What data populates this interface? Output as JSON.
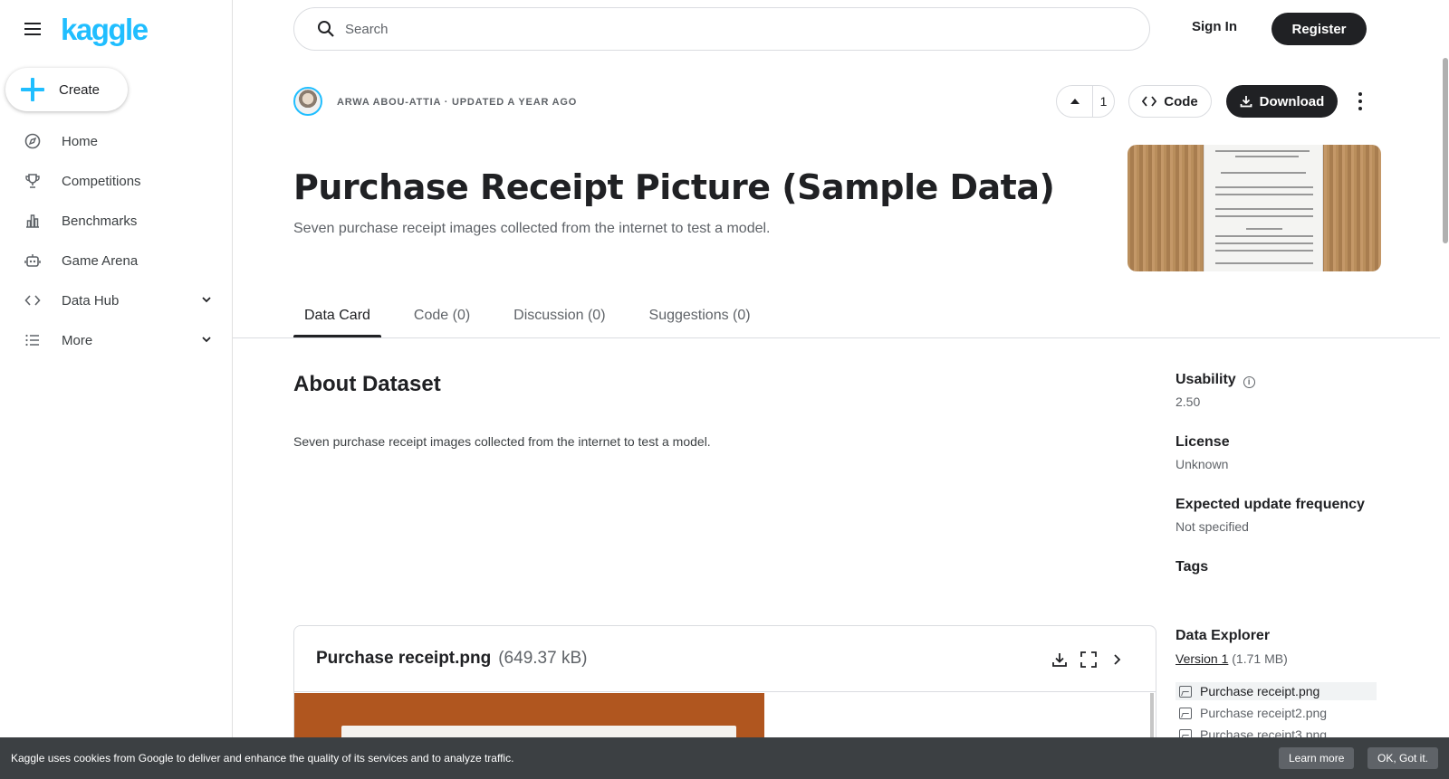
{
  "logo": "kaggle",
  "create_label": "Create",
  "nav": {
    "items": [
      {
        "label": "Home"
      },
      {
        "label": "Competitions"
      },
      {
        "label": "Benchmarks"
      },
      {
        "label": "Game Arena"
      },
      {
        "label": "Data Hub"
      },
      {
        "label": "More"
      }
    ]
  },
  "search": {
    "placeholder": "Search"
  },
  "auth": {
    "signin": "Sign In",
    "register": "Register"
  },
  "dataset": {
    "meta": "ARWA ABOU-ATTIA · UPDATED A YEAR AGO",
    "votes": "1",
    "code_label": "Code",
    "download_label": "Download",
    "title": "Purchase Receipt Picture (Sample Data)",
    "subtitle": "Seven purchase receipt images collected from the internet to test a model."
  },
  "tabs": [
    {
      "label": "Data Card"
    },
    {
      "label": "Code (0)"
    },
    {
      "label": "Discussion (0)"
    },
    {
      "label": "Suggestions (0)"
    }
  ],
  "about": {
    "heading": "About Dataset",
    "body": "Seven purchase receipt images collected from the internet to test a model."
  },
  "sidebar_meta": {
    "usability_label": "Usability",
    "usability_value": "2.50",
    "license_label": "License",
    "license_value": "Unknown",
    "frequency_label": "Expected update frequency",
    "frequency_value": "Not specified",
    "tags_label": "Tags",
    "explorer_label": "Data Explorer",
    "version_link": "Version 1",
    "version_size": " (1.71 MB)",
    "files": [
      "Purchase receipt.png",
      "Purchase receipt2.png",
      "Purchase receipt3.png"
    ]
  },
  "file_preview": {
    "name": "Purchase receipt.png",
    "size": "(649.37 kB)"
  },
  "cookie": {
    "text": "Kaggle uses cookies from Google to deliver and enhance the quality of its services and to analyze traffic.",
    "learn_more": "Learn more",
    "ok": "OK, Got it."
  },
  "colors": {
    "brand": "#20beff",
    "dark": "#202124",
    "cookie_bg": "#3c4043"
  },
  "icons": [
    "menu-icon",
    "search-icon",
    "compass-icon",
    "trophy-icon",
    "bar-chart-icon",
    "robot-icon",
    "code-icon",
    "list-icon",
    "chevron-down-icon",
    "arrow-up-icon",
    "download-icon",
    "kebab-icon",
    "info-icon",
    "image-icon",
    "fullscreen-icon",
    "chevron-right-icon"
  ]
}
